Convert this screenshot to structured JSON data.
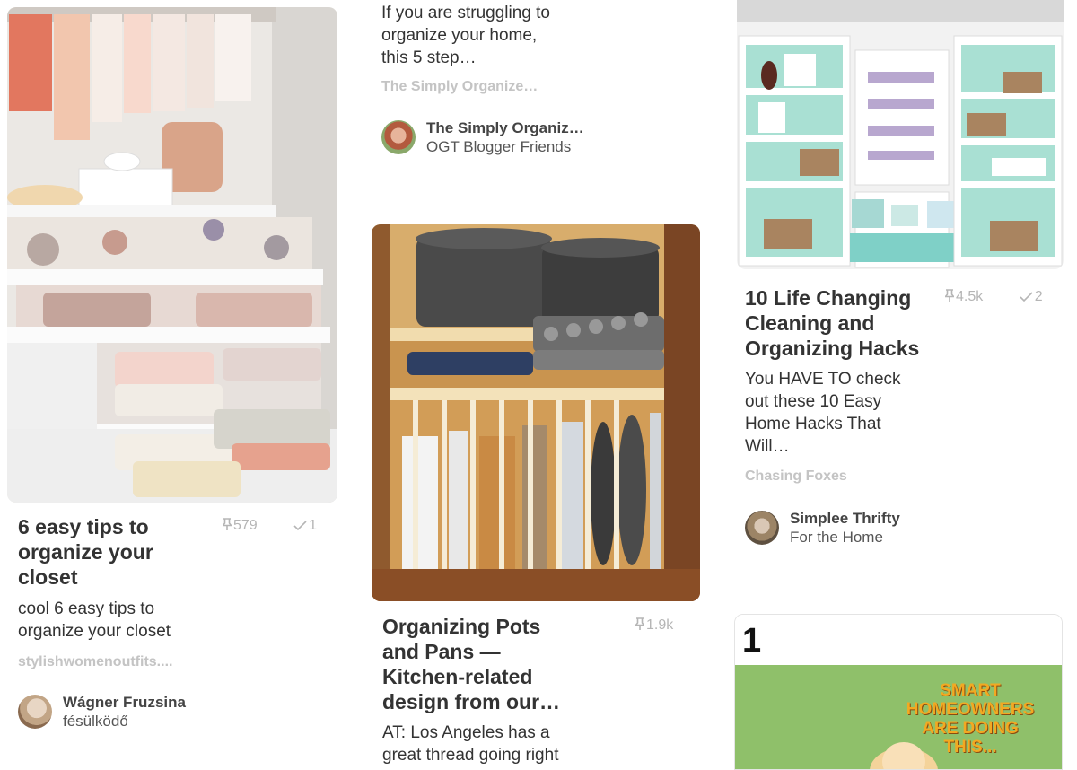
{
  "pins": [
    {
      "title": "6 easy tips to organize your closet",
      "title_lines": [
        "6 easy tips to",
        "organize your",
        "closet"
      ],
      "repins": "579",
      "likes": "1",
      "description_lines": [
        "cool 6 easy tips to",
        "organize your closet"
      ],
      "source": "stylishwomenoutfits....",
      "pinner": "Wágner Fruzsina",
      "board": "fésülködő"
    },
    {
      "description_lines": [
        "If you are struggling to",
        "organize your home,",
        "this 5 step…"
      ],
      "source": "The Simply Organize…",
      "pinner": "The Simply Organiz…",
      "board": "OGT Blogger Friends"
    },
    {
      "title_lines": [
        "Organizing Pots",
        "and Pans —",
        "Kitchen-related",
        "design from our…"
      ],
      "repins": "1.9k",
      "description_lines": [
        "AT: Los Angeles has a",
        "great thread going right"
      ]
    },
    {
      "title_lines": [
        "10 Life Changing",
        "Cleaning and",
        "Organizing Hacks"
      ],
      "repins": "4.5k",
      "likes": "2",
      "description_lines": [
        "You HAVE TO check",
        "out these 10 Easy",
        "Home Hacks That",
        "Will…"
      ],
      "source": "Chasing Foxes",
      "pinner": "Simplee Thrifty",
      "board": "For the Home"
    },
    {
      "image_number": "1",
      "image_text_lines": [
        "SMART",
        "HOMEOWNERS",
        "ARE DOING",
        "THIS..."
      ]
    }
  ],
  "icons": {
    "repin": "pushpin-icon",
    "like": "check-icon"
  },
  "colors": {
    "stats": "#b5b5b5",
    "source": "#c4c4c4",
    "title": "#333333",
    "sign_bg": "#8fc06a",
    "sign_text": "#f2a922"
  }
}
